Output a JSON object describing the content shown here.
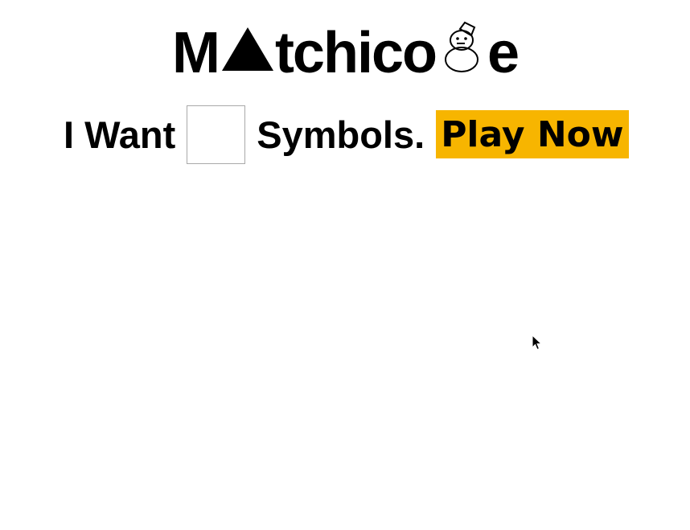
{
  "logo": {
    "part1": "M",
    "part2": "tchico",
    "part3": "e",
    "symbol1": "triangle-icon",
    "symbol2": "snowman-icon"
  },
  "form": {
    "want_label": "I Want",
    "count_value": "",
    "symbols_label": "Symbols.",
    "play_label": "Play Now"
  },
  "colors": {
    "play_button": "#f7b500",
    "input_border": "#a9a9a9"
  },
  "cursor": "arrow-cursor-icon"
}
